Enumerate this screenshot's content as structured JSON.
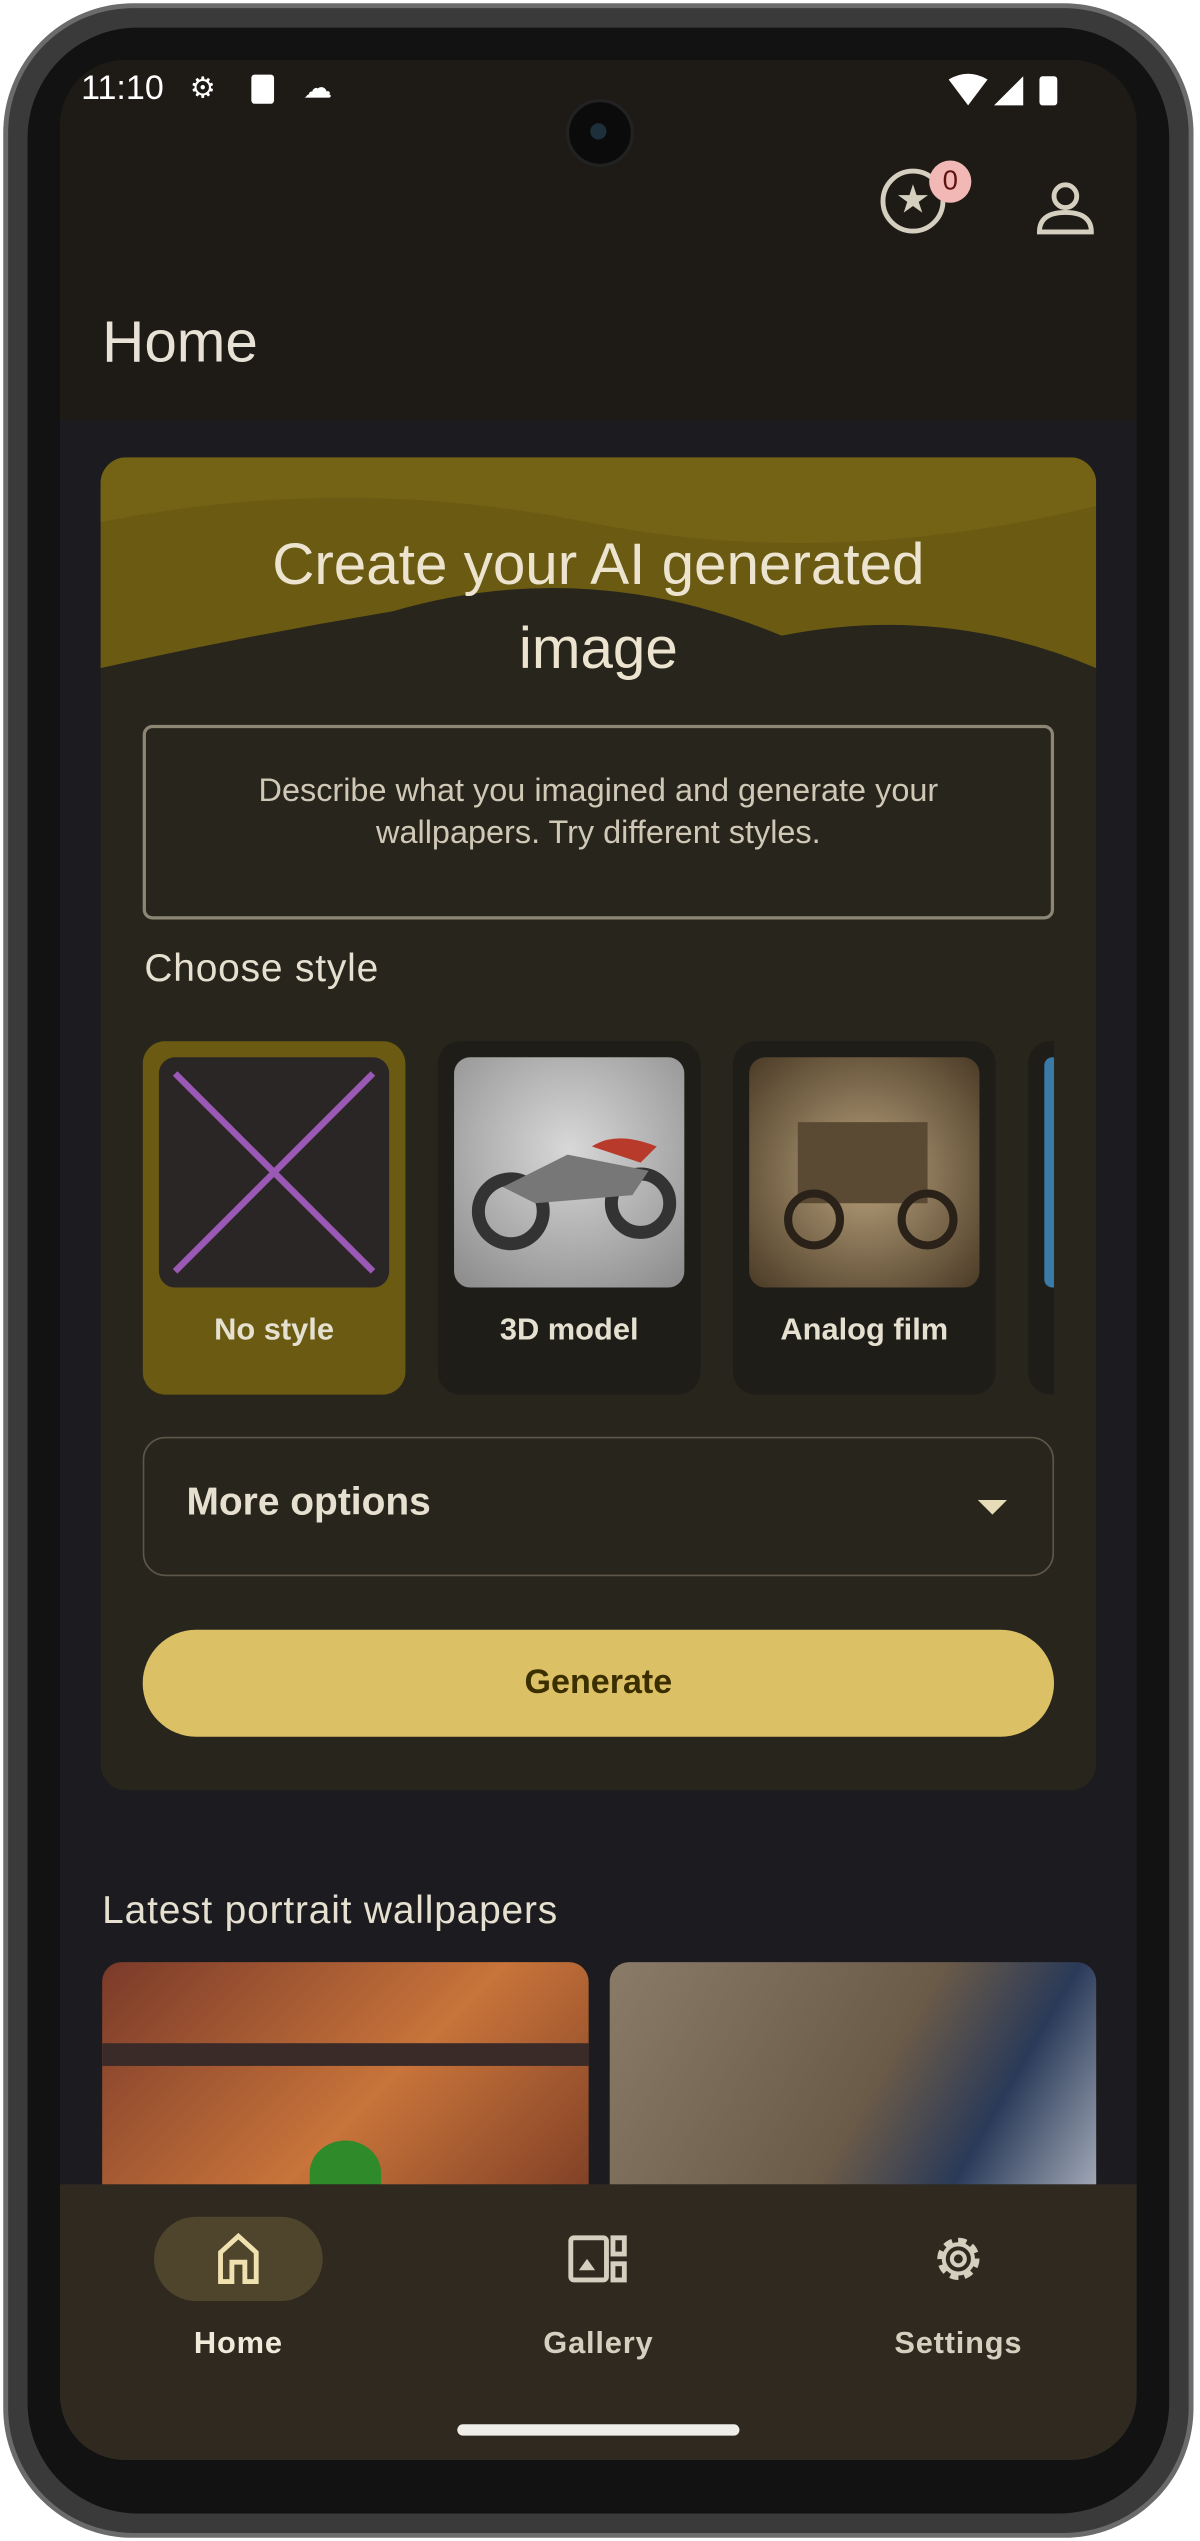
{
  "status_bar": {
    "time": "11:10",
    "icons": [
      "gear-icon",
      "sd-card-icon",
      "cloud-icon",
      "wifi-icon",
      "signal-icon",
      "battery-icon"
    ]
  },
  "app_bar": {
    "title": "Home",
    "awards_count": "0"
  },
  "create_card": {
    "heading": "Create your AI generated image",
    "description": "Describe what you imagined and generate your wallpapers. Try different styles.",
    "choose_style_label": "Choose style",
    "styles": [
      {
        "label": "No style",
        "selected": true
      },
      {
        "label": "3D model",
        "selected": false
      },
      {
        "label": "Analog film",
        "selected": false
      }
    ],
    "more_options_label": "More options",
    "generate_label": "Generate"
  },
  "latest": {
    "title": "Latest portrait wallpapers"
  },
  "bottom_nav": {
    "items": [
      {
        "label": "Home",
        "active": true
      },
      {
        "label": "Gallery",
        "active": false
      },
      {
        "label": "Settings",
        "active": false
      }
    ]
  },
  "colors": {
    "accent": "#dcc066",
    "selected_style": "#6b5a12",
    "nav_bg": "#2f2920",
    "badge": "#f2b8b5"
  }
}
